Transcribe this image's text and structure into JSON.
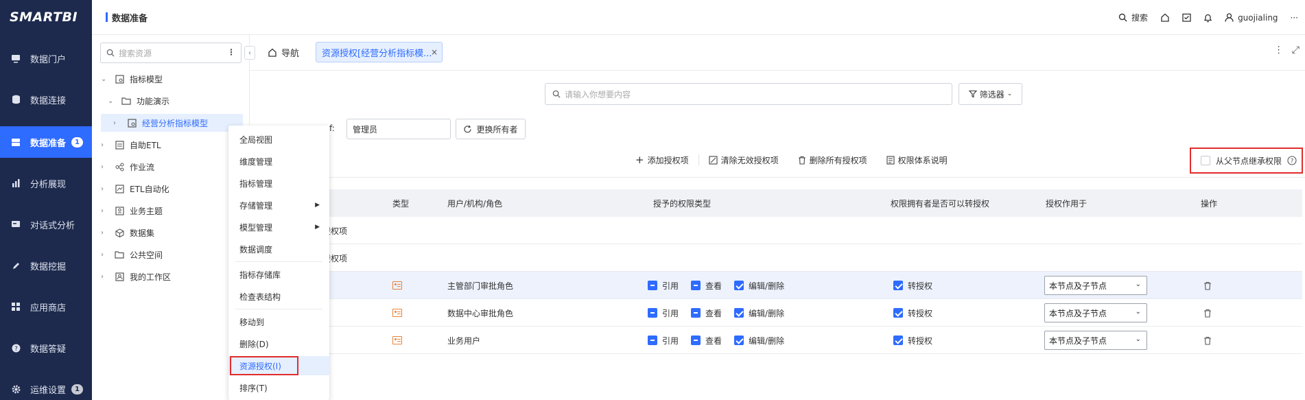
{
  "app": {
    "logo": "SMARTBI",
    "header_title": "数据准备"
  },
  "colors": {
    "nav_bg": "#1d2a4d",
    "accent": "#2e6bff",
    "highlight_border": "#e12c2c",
    "type_icon": "#e8823a"
  },
  "topright": {
    "search": "搜索",
    "user": "guojialing",
    "more": "···"
  },
  "sidebar": {
    "items": [
      {
        "label": "数据门户",
        "icon": "monitor-icon"
      },
      {
        "label": "数据连接",
        "icon": "database-icon"
      },
      {
        "label": "数据准备",
        "icon": "server-icon",
        "badge": "1",
        "active": true
      },
      {
        "label": "分析展现",
        "icon": "bar-chart-icon"
      },
      {
        "label": "对话式分析",
        "icon": "chat-icon"
      },
      {
        "label": "数据挖掘",
        "icon": "pen-icon"
      },
      {
        "label": "应用商店",
        "icon": "grid-icon"
      },
      {
        "label": "数据答疑",
        "icon": "help-icon"
      },
      {
        "label": "运维设置",
        "icon": "gear-icon",
        "badge": "1"
      }
    ]
  },
  "tree": {
    "search_placeholder": "搜索资源",
    "items": [
      {
        "label": "指标模型",
        "chevron": "⌄",
        "icon": "model-icon"
      },
      {
        "label": "功能演示",
        "chevron": "⌄",
        "icon": "folder-icon"
      },
      {
        "label": "经营分析指标模型",
        "chevron": "›",
        "icon": "model-icon",
        "selected": true
      },
      {
        "label": "自助ETL",
        "chevron": "›",
        "icon": "etl-icon"
      },
      {
        "label": "作业流",
        "chevron": "›",
        "icon": "flow-icon"
      },
      {
        "label": "ETL自动化",
        "chevron": "›",
        "icon": "etl-auto-icon"
      },
      {
        "label": "业务主题",
        "chevron": "›",
        "icon": "topic-icon"
      },
      {
        "label": "数据集",
        "chevron": "›",
        "icon": "cube-icon"
      },
      {
        "label": "公共空间",
        "chevron": "›",
        "icon": "folder-icon"
      },
      {
        "label": "我的工作区",
        "chevron": "›",
        "icon": "workspace-icon"
      }
    ]
  },
  "context_menu": {
    "items": [
      {
        "label": "全局视图"
      },
      {
        "label": "维度管理"
      },
      {
        "label": "指标管理"
      },
      {
        "label": "存储管理",
        "submenu": true
      },
      {
        "label": "模型管理",
        "submenu": true
      },
      {
        "label": "数据调度"
      },
      {
        "label": "指标存储库"
      },
      {
        "label": "检查表结构"
      },
      {
        "label": "移动到"
      },
      {
        "label": "删除(D)"
      },
      {
        "label": "资源授权(I)",
        "active": true
      },
      {
        "label": "排序(T)"
      }
    ]
  },
  "tabs": {
    "nav_label": "导航",
    "active_label": "资源授权[经营分析指标模...",
    "close": "×"
  },
  "main": {
    "search_placeholder": "请输入你想要内容",
    "filter_label": "筛选器",
    "owner_label_fragment": "f:",
    "owner_value": "管理员",
    "change_owner_label": "更换所有者",
    "actions": {
      "add": "添加授权项",
      "clear_invalid": "清除无效授权项",
      "delete_all": "删除所有授权项",
      "explain": "权限体系说明"
    },
    "inherit_label": "从父节点继承权限"
  },
  "table": {
    "columns": [
      "类型",
      "用户/机构/角色",
      "授予的权限类型",
      "权限拥有者是否可以转授权",
      "授权作用于",
      "操作"
    ],
    "group_rows": [
      "授权项",
      "授权项"
    ],
    "rows": [
      {
        "name": "主管部门审批角色",
        "perms": [
          "引用",
          "查看",
          "编辑/删除"
        ],
        "transfer": "转授权",
        "scope": "本节点及子节点"
      },
      {
        "name": "数据中心审批角色",
        "perms": [
          "引用",
          "查看",
          "编辑/删除"
        ],
        "transfer": "转授权",
        "scope": "本节点及子节点"
      },
      {
        "name": "业务用户",
        "perms": [
          "引用",
          "查看",
          "编辑/删除"
        ],
        "transfer": "转授权",
        "scope": "本节点及子节点"
      }
    ]
  }
}
